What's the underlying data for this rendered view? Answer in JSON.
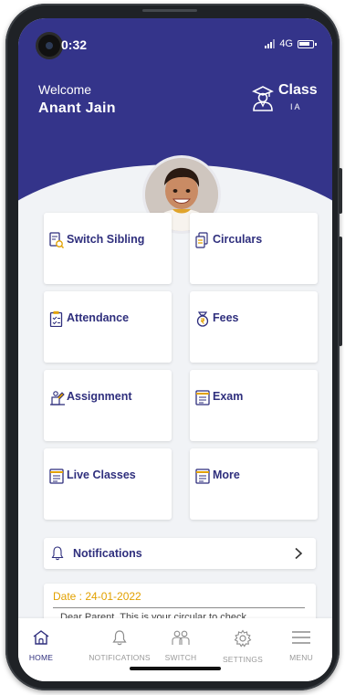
{
  "status_bar": {
    "time": "0:32",
    "network": "4G"
  },
  "header": {
    "welcome": "Welcome",
    "user_name": "Anant  Jain",
    "class_title": "Class",
    "class_value": "I A"
  },
  "tiles": [
    {
      "label": "Switch Sibling",
      "icon": "switch-sibling-icon"
    },
    {
      "label": "Circulars",
      "icon": "circulars-icon"
    },
    {
      "label": "Attendance",
      "icon": "attendance-icon"
    },
    {
      "label": "Fees",
      "icon": "fees-icon"
    },
    {
      "label": "Assignment",
      "icon": "assignment-icon"
    },
    {
      "label": "Exam",
      "icon": "exam-icon"
    },
    {
      "label": "Live Classes",
      "icon": "live-classes-icon"
    },
    {
      "label": "More",
      "icon": "more-icon"
    }
  ],
  "notifications_bar": {
    "label": "Notifications"
  },
  "circular": {
    "date": "Date : 24-01-2022",
    "preview": "Dear Parent, This is your circular to check"
  },
  "bottom_nav": [
    {
      "label": "HOME",
      "icon": "home-icon"
    },
    {
      "label": "NOTIFICATIONS",
      "icon": "bell-icon"
    },
    {
      "label": "SWITCH",
      "icon": "switch-icon"
    },
    {
      "label": "SETTINGS",
      "icon": "settings-icon"
    },
    {
      "label": "MENU",
      "icon": "menu-icon"
    }
  ],
  "colors": {
    "header_bg": "#34348a",
    "accent_text": "#2f2f7d",
    "date_text": "#e2a100",
    "page_bg": "#f1f3f6"
  }
}
